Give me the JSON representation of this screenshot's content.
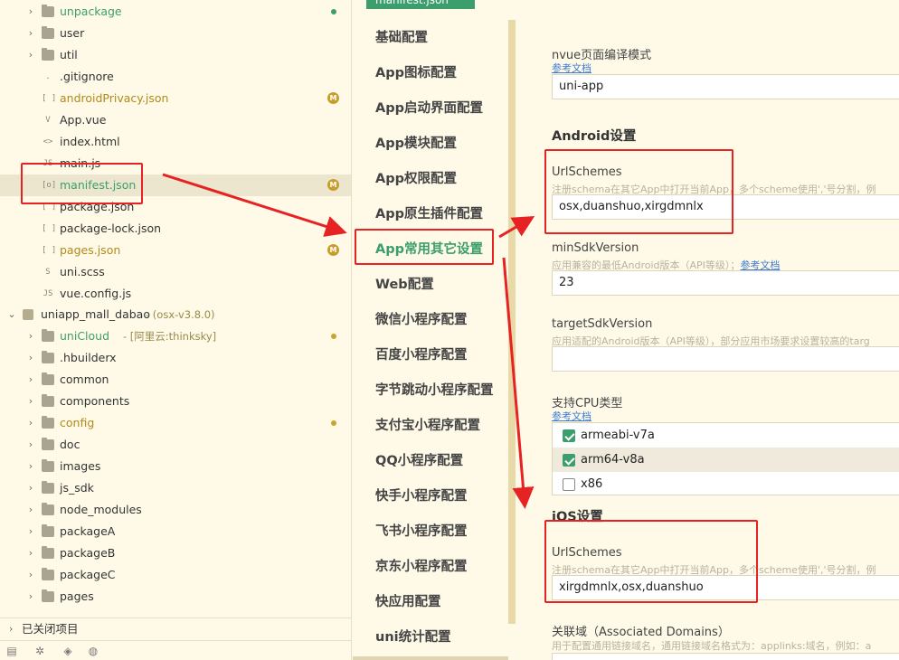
{
  "file_tree": {
    "items": [
      {
        "label": "unpackage",
        "kind": "folder",
        "style": "green",
        "marker": "dot-green"
      },
      {
        "label": "user",
        "kind": "folder"
      },
      {
        "label": "util",
        "kind": "folder"
      },
      {
        "label": ".gitignore",
        "kind": "file"
      },
      {
        "label": "androidPrivacy.json",
        "kind": "json",
        "style": "gold",
        "marker": "M"
      },
      {
        "label": "App.vue",
        "kind": "vue"
      },
      {
        "label": "index.html",
        "kind": "html"
      },
      {
        "label": "main.js",
        "kind": "js"
      },
      {
        "label": "manifest.json",
        "kind": "manifest",
        "style": "green",
        "marker": "M",
        "selected": true
      },
      {
        "label": "package.json",
        "kind": "json"
      },
      {
        "label": "package-lock.json",
        "kind": "json"
      },
      {
        "label": "pages.json",
        "kind": "json",
        "style": "gold",
        "marker": "M"
      },
      {
        "label": "uni.scss",
        "kind": "scss"
      },
      {
        "label": "vue.config.js",
        "kind": "js"
      }
    ],
    "project": {
      "label": "uniapp_mall_dabao",
      "branch": "- (osx-v3.8.0)"
    },
    "project_items": [
      {
        "label": "uniCloud",
        "sub": "- [阿里云:thinksky]",
        "style": "green",
        "marker": "dot-gold"
      },
      {
        "label": ".hbuilderx"
      },
      {
        "label": "common"
      },
      {
        "label": "components"
      },
      {
        "label": "config",
        "style": "gold",
        "marker": "dot-gold"
      },
      {
        "label": "doc"
      },
      {
        "label": "images"
      },
      {
        "label": "js_sdk"
      },
      {
        "label": "node_modules"
      },
      {
        "label": "packageA"
      },
      {
        "label": "packageB"
      },
      {
        "label": "packageC"
      },
      {
        "label": "pages"
      }
    ],
    "closed_projects": "已关闭项目",
    "badge_letter": "M"
  },
  "editor_tab": "manifest.json",
  "nav": {
    "items": [
      "基础配置",
      "App图标配置",
      "App启动界面配置",
      "App模块配置",
      "App权限配置",
      "App原生插件配置",
      "App常用其它设置",
      "Web配置",
      "微信小程序配置",
      "百度小程序配置",
      "字节跳动小程序配置",
      "支付宝小程序配置",
      "QQ小程序配置",
      "快手小程序配置",
      "飞书小程序配置",
      "京东小程序配置",
      "快应用配置",
      "uni统计配置"
    ],
    "active_index": 6
  },
  "content": {
    "nvue": {
      "label": "nvue页面编译模式",
      "doc_link": "参考文档",
      "value": "uni-app"
    },
    "android": {
      "title": "Android设置",
      "url_schemes": {
        "label": "UrlSchemes",
        "hint": "注册schema在其它App中打开当前App，多个scheme使用','号分割，例",
        "value": "osx,duanshuo,xirgdmnlx"
      },
      "min_sdk": {
        "label": "minSdkVersion",
        "hint": "应用兼容的最低Android版本（API等级）；",
        "doc_link": "参考文档",
        "value": "23"
      },
      "target_sdk": {
        "label": "targetSdkVersion",
        "hint": "应用适配的Android版本（API等级），部分应用市场要求设置较高的targ",
        "value": ""
      },
      "cpu": {
        "label": "支持CPU类型",
        "doc_link": "参考文档",
        "options": [
          {
            "label": "armeabi-v7a",
            "checked": true
          },
          {
            "label": "arm64-v8a",
            "checked": true
          },
          {
            "label": "x86",
            "checked": false
          }
        ]
      }
    },
    "ios": {
      "title": "iOS设置",
      "url_schemes": {
        "label": "UrlSchemes",
        "hint": "注册schema在其它App中打开当前App，多个scheme使用','号分割，例",
        "value": "xirgdmnlx,osx,duanshuo"
      },
      "associated_domains": {
        "label": "关联域（Associated Domains）",
        "hint": "用于配置通用链接域名，通用链接域名格式为：applinks:域名，例如：a"
      }
    }
  },
  "colors": {
    "accent_green": "#3c9e6c",
    "annotation_red": "#e62222",
    "background": "#fffae8",
    "link_blue": "#3a7bd5"
  },
  "icons": {
    "folder": "folder-icon",
    "chevron": "chevron-right-icon",
    "checkbox": "checkbox-icon",
    "bottom_bar": [
      "explorer-icon",
      "debug-icon",
      "extensions-icon"
    ]
  }
}
